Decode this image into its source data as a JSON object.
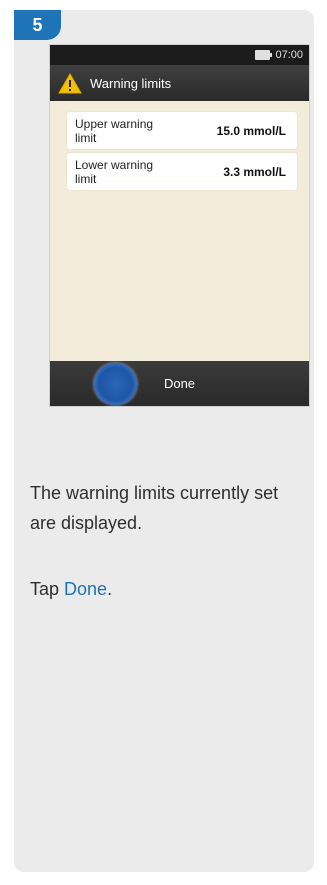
{
  "step": {
    "number": "5"
  },
  "device": {
    "status_time": "07:00",
    "title": "Warning limits",
    "rows": [
      {
        "label": "Upper warning limit",
        "value": "15.0 mmol/L"
      },
      {
        "label": "Lower warning limit",
        "value": "3.3 mmol/L"
      }
    ],
    "done_label": "Done"
  },
  "instructions": {
    "line1": "The warning limits currently set are displayed.",
    "line2_prefix": "Tap ",
    "line2_link": "Done",
    "line2_suffix": "."
  },
  "icons": [
    "battery-icon",
    "warning-icon"
  ],
  "colors": {
    "accent": "#1f73b7",
    "warning": "#f2c200",
    "screen_bg": "#f3ecda"
  }
}
